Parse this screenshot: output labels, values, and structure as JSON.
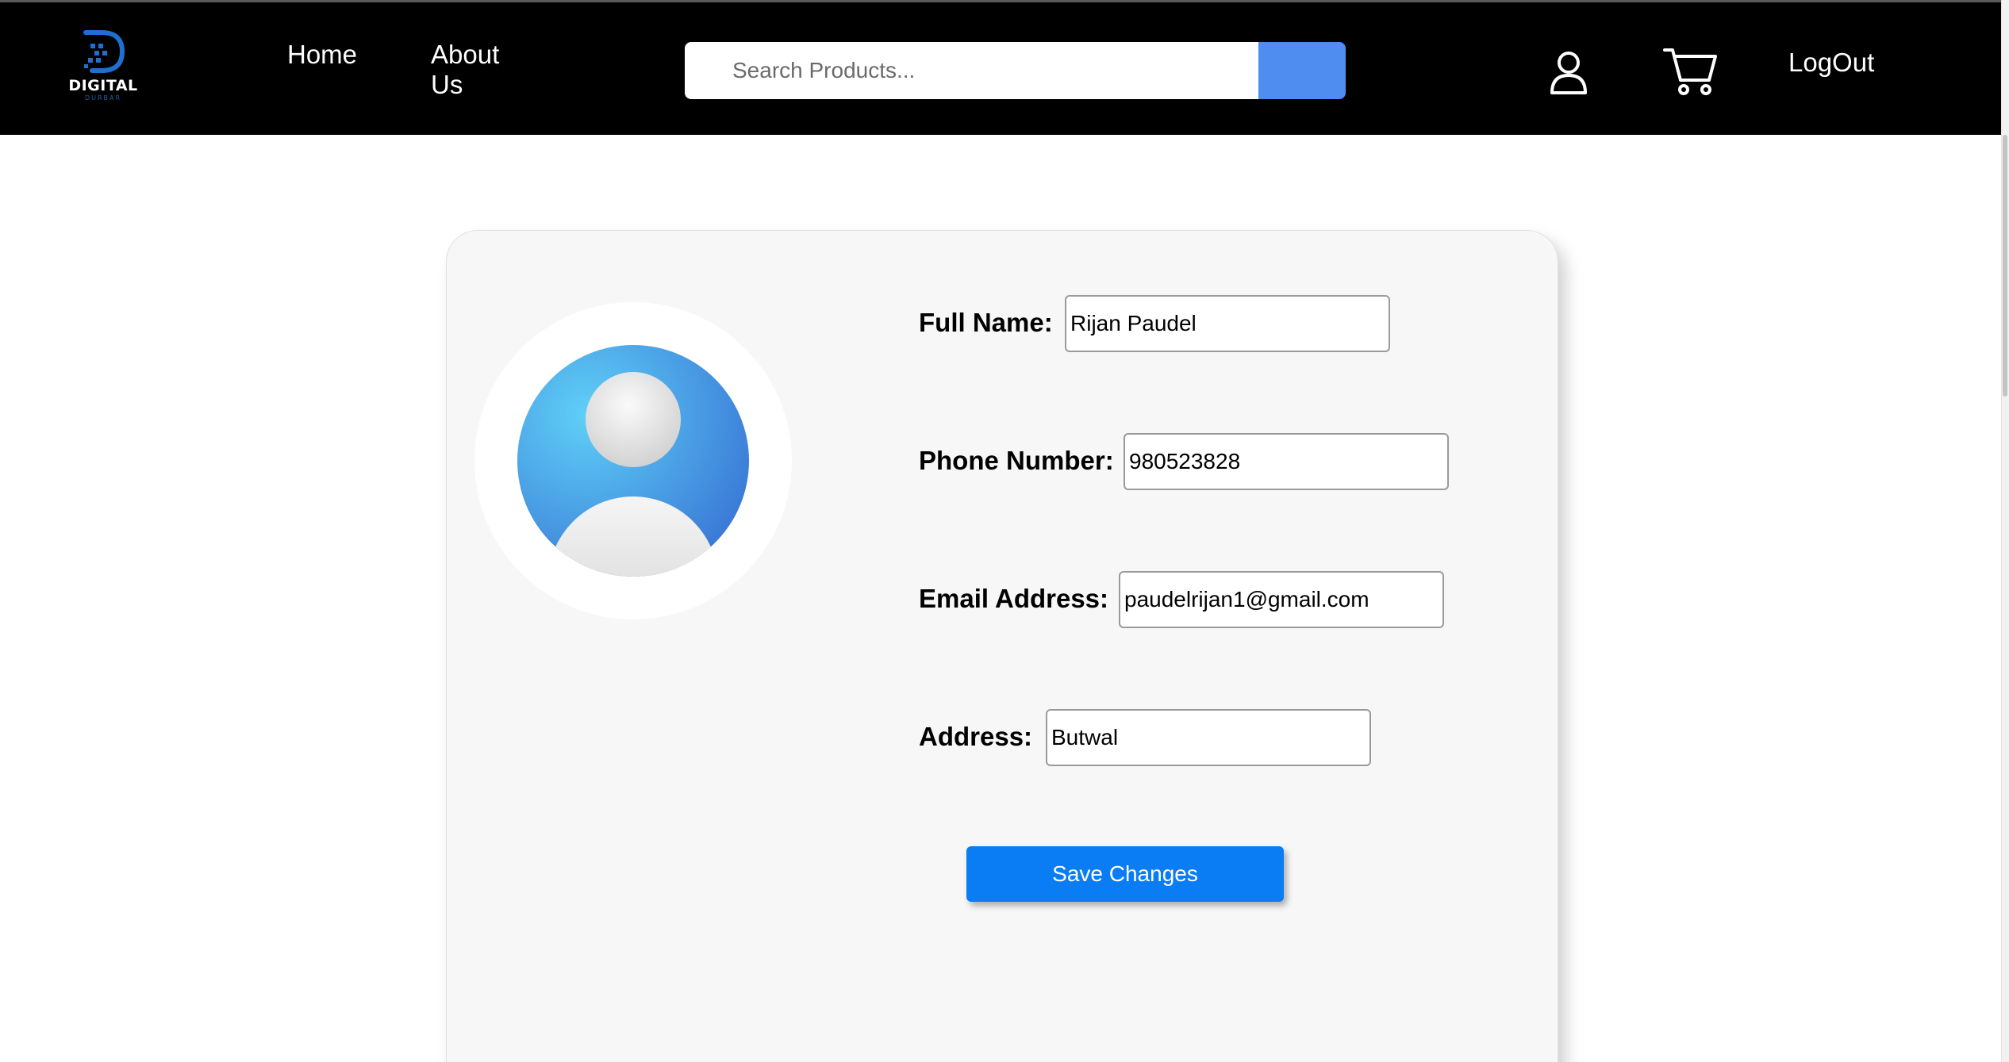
{
  "colors": {
    "header_bg": "#000000",
    "search_button": "#4f8df0",
    "save_button": "#0a7df5",
    "card_bg": "#f7f7f7"
  },
  "header": {
    "logo": {
      "icon": "digital-durbar-logo",
      "name": "DIGITAL",
      "tagline": "DURBAR"
    },
    "nav": {
      "home": "Home",
      "about": "About Us"
    },
    "search": {
      "placeholder": "Search Products...",
      "value": ""
    },
    "icons": {
      "user": "user-icon",
      "cart": "cart-icon"
    },
    "logout": "LogOut"
  },
  "profile": {
    "avatar_icon": "user-avatar-icon",
    "fields": {
      "full_name": {
        "label": "Full Name:",
        "value": "Rijan Paudel"
      },
      "phone": {
        "label": "Phone Number:",
        "value": "980523828"
      },
      "email": {
        "label": "Email Address:",
        "value": "paudelrijan1@gmail.com"
      },
      "address": {
        "label": "Address:",
        "value": "Butwal"
      }
    },
    "save_label": "Save Changes"
  }
}
